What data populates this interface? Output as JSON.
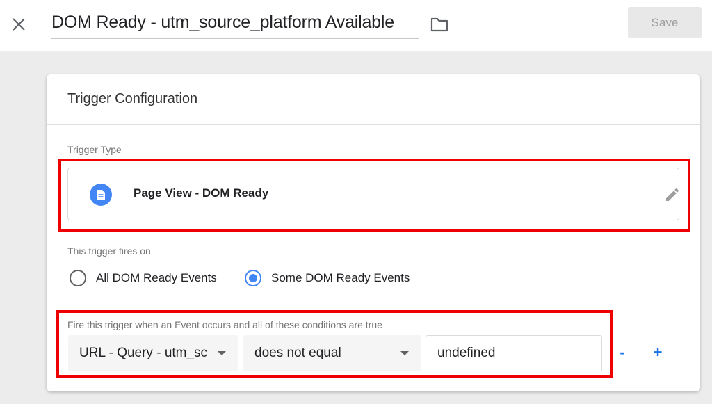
{
  "header": {
    "title": "DOM Ready - utm_source_platform Available",
    "save_label": "Save"
  },
  "card": {
    "title": "Trigger Configuration",
    "trigger_type_label": "Trigger Type",
    "trigger_type_value": "Page View - DOM Ready",
    "fires_on_label": "This trigger fires on",
    "fires_on_options": [
      {
        "label": "All DOM Ready Events",
        "selected": false
      },
      {
        "label": "Some DOM Ready Events",
        "selected": true
      }
    ],
    "condition_description": "Fire this trigger when an Event occurs and all of these conditions are true",
    "condition": {
      "variable": "URL - Query - utm_sc",
      "operator": "does not equal",
      "value": "undefined"
    },
    "remove_label": "-",
    "add_label": "+"
  },
  "colors": {
    "accent": "#4285f4",
    "highlight": "#ee0000",
    "link": "#1a73e8"
  },
  "icons": [
    "close-icon",
    "folder-icon",
    "document-icon",
    "pencil-icon",
    "dropdown-arrow-icon"
  ]
}
